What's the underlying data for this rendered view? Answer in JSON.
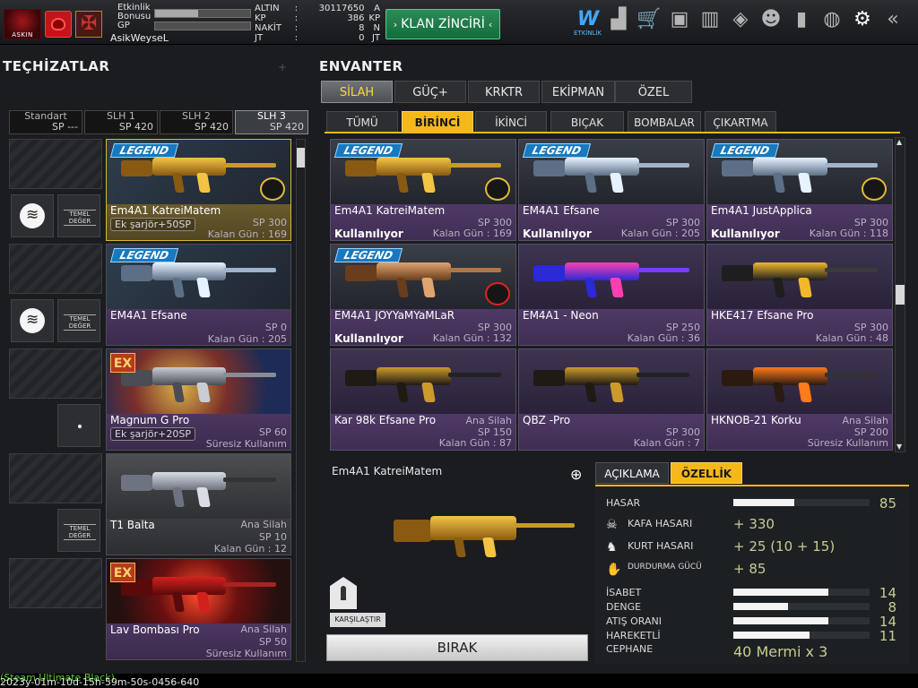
{
  "player": {
    "logo_text": "ASKIN",
    "bonus_label": "Etkinlik Bonusu",
    "bonus_fill": 0.45,
    "gp_label": "GP",
    "gp_fill": 0.0,
    "username": "AsikWeyseL"
  },
  "currency": [
    {
      "key": "ALTIN",
      "sep": ":",
      "value": "30117650",
      "unit": "A"
    },
    {
      "key": "KP",
      "sep": ":",
      "value": "386",
      "unit": "KP"
    },
    {
      "key": "NAKİT",
      "sep": ":",
      "value": "8",
      "unit": "N"
    },
    {
      "key": "JT",
      "sep": ":",
      "value": "0",
      "unit": "JT"
    }
  ],
  "clan_button": "KLAN ZİNCİRİ",
  "top_icons": [
    "event-icon",
    "rank-chart-icon",
    "shop-cart-icon",
    "briefcase-icon",
    "barracks-icon",
    "box-icon",
    "friends-icon",
    "stats-icon",
    "globe-icon",
    "settings-gear-icon",
    "back-icon"
  ],
  "event_label": "ETKİNLİK",
  "left": {
    "title": "TEÇHİZATLAR",
    "loadouts": [
      {
        "name": "Standart",
        "sp": "SP ---"
      },
      {
        "name": "SLH 1",
        "sp": "SP 420"
      },
      {
        "name": "SLH 2",
        "sp": "SP 420"
      },
      {
        "name": "SLH 3",
        "sp": "SP 420"
      }
    ],
    "temel_label": "TEMEL DEĞER",
    "slots": [
      {
        "name": "Em4A1 KatreiMatem",
        "tag": "Ek şarjör+50SP",
        "sp": "SP 300",
        "days": "Kalan Gün : 169",
        "badge": "legend"
      },
      {
        "name": "EM4A1 Efsane",
        "sp": "SP 0",
        "days": "Kalan Gün : 205",
        "badge": "legend"
      },
      {
        "name": "Magnum G Pro",
        "tag": "Ek şarjör+20SP",
        "sp": "SP 60",
        "days": "Süresiz Kullanım",
        "badge": "ex"
      },
      {
        "name": "T1 Balta",
        "category": "Ana Silah",
        "sp": "SP 10",
        "days": "Kalan Gün : 12"
      },
      {
        "name": "Lav Bombası Pro",
        "category": "Ana Silah",
        "sp": "SP 50",
        "days": "Süresiz Kullanım",
        "badge": "ex"
      }
    ]
  },
  "inventory": {
    "title": "ENVANTER",
    "tabs": [
      "SİLAH",
      "GÜÇ+",
      "KRKTR",
      "EKİPMAN",
      "ÖZEL"
    ],
    "subtabs": [
      "TÜMÜ",
      "BİRİNCİ",
      "İKİNCİ",
      "BIÇAK",
      "BOMBALAR",
      "ÇIKARTMA"
    ],
    "legend_text": "LEGEND",
    "ex_text": "EX",
    "items": [
      {
        "name": "Em4A1 KatreiMatem",
        "sp": "SP 300",
        "days": "Kalan Gün : 169",
        "status": "Kullanılıyor",
        "badge": "legend"
      },
      {
        "name": "EM4A1 Efsane",
        "sp": "SP 300",
        "days": "Kalan Gün : 205",
        "status": "Kullanılıyor",
        "badge": "legend"
      },
      {
        "name": "Em4A1 JustApplica",
        "sp": "SP 300",
        "days": "Kalan Gün : 118",
        "status": "Kullanılıyor",
        "badge": "legend"
      },
      {
        "name": "EM4A1 JOYYaMYaMLaR",
        "sp": "SP 300",
        "days": "Kalan Gün : 132",
        "status": "Kullanılıyor",
        "badge": "legend"
      },
      {
        "name": "EM4A1 - Neon",
        "sp": "SP 250",
        "days": "Kalan Gün : 36"
      },
      {
        "name": "HKE417 Efsane Pro",
        "sp": "SP 300",
        "days": "Kalan Gün : 48"
      },
      {
        "name": "Kar 98k Efsane Pro",
        "category": "Ana Silah",
        "sp": "SP 150",
        "days": "Kalan Gün : 87"
      },
      {
        "name": "QBZ -Pro",
        "sp": "SP 300",
        "days": "Kalan Gün : 7"
      },
      {
        "name": "HKNOB-21 Korku",
        "category": "Ana Silah",
        "sp": "SP 200",
        "days": "Süresiz Kullanım"
      }
    ]
  },
  "detail": {
    "name": "Em4A1 KatreiMatem",
    "compare": "KARŞILAŞTIR",
    "drop": "BIRAK",
    "tabs": [
      "AÇIKLAMA",
      "ÖZELLİK"
    ],
    "damage": {
      "label": "HASAR",
      "value": "85",
      "fill": 0.45
    },
    "bonuses": [
      {
        "icon": "head-icon",
        "label": "KAFA HASARI",
        "value": "+ 330"
      },
      {
        "icon": "wolf-icon",
        "label": "KURT HASARI",
        "value": "+ 25 (10 + 15)"
      },
      {
        "icon": "stun-icon",
        "label": "DURDURMA GÜCÜ",
        "value": "+ 85"
      }
    ],
    "stats": [
      {
        "label": "İSABET",
        "value": "14",
        "fill": 0.7
      },
      {
        "label": "DENGE",
        "value": "8",
        "fill": 0.4
      },
      {
        "label": "ATIŞ ORANI",
        "value": "14",
        "fill": 0.7
      },
      {
        "label": "HAREKETLİ",
        "value": "11",
        "fill": 0.56
      }
    ],
    "ammo_label": "CEPHANE",
    "ammo_value": "40 Mermi x 3"
  },
  "footer": {
    "line1": "(Steam Ultimate Black)",
    "line2": "2023y-01m-10d-15h-59m-50s-0456-640"
  },
  "colors": {
    "accent": "#f4b81a",
    "clan_green": "#1f7a48",
    "card_purple": "#4a3660"
  }
}
